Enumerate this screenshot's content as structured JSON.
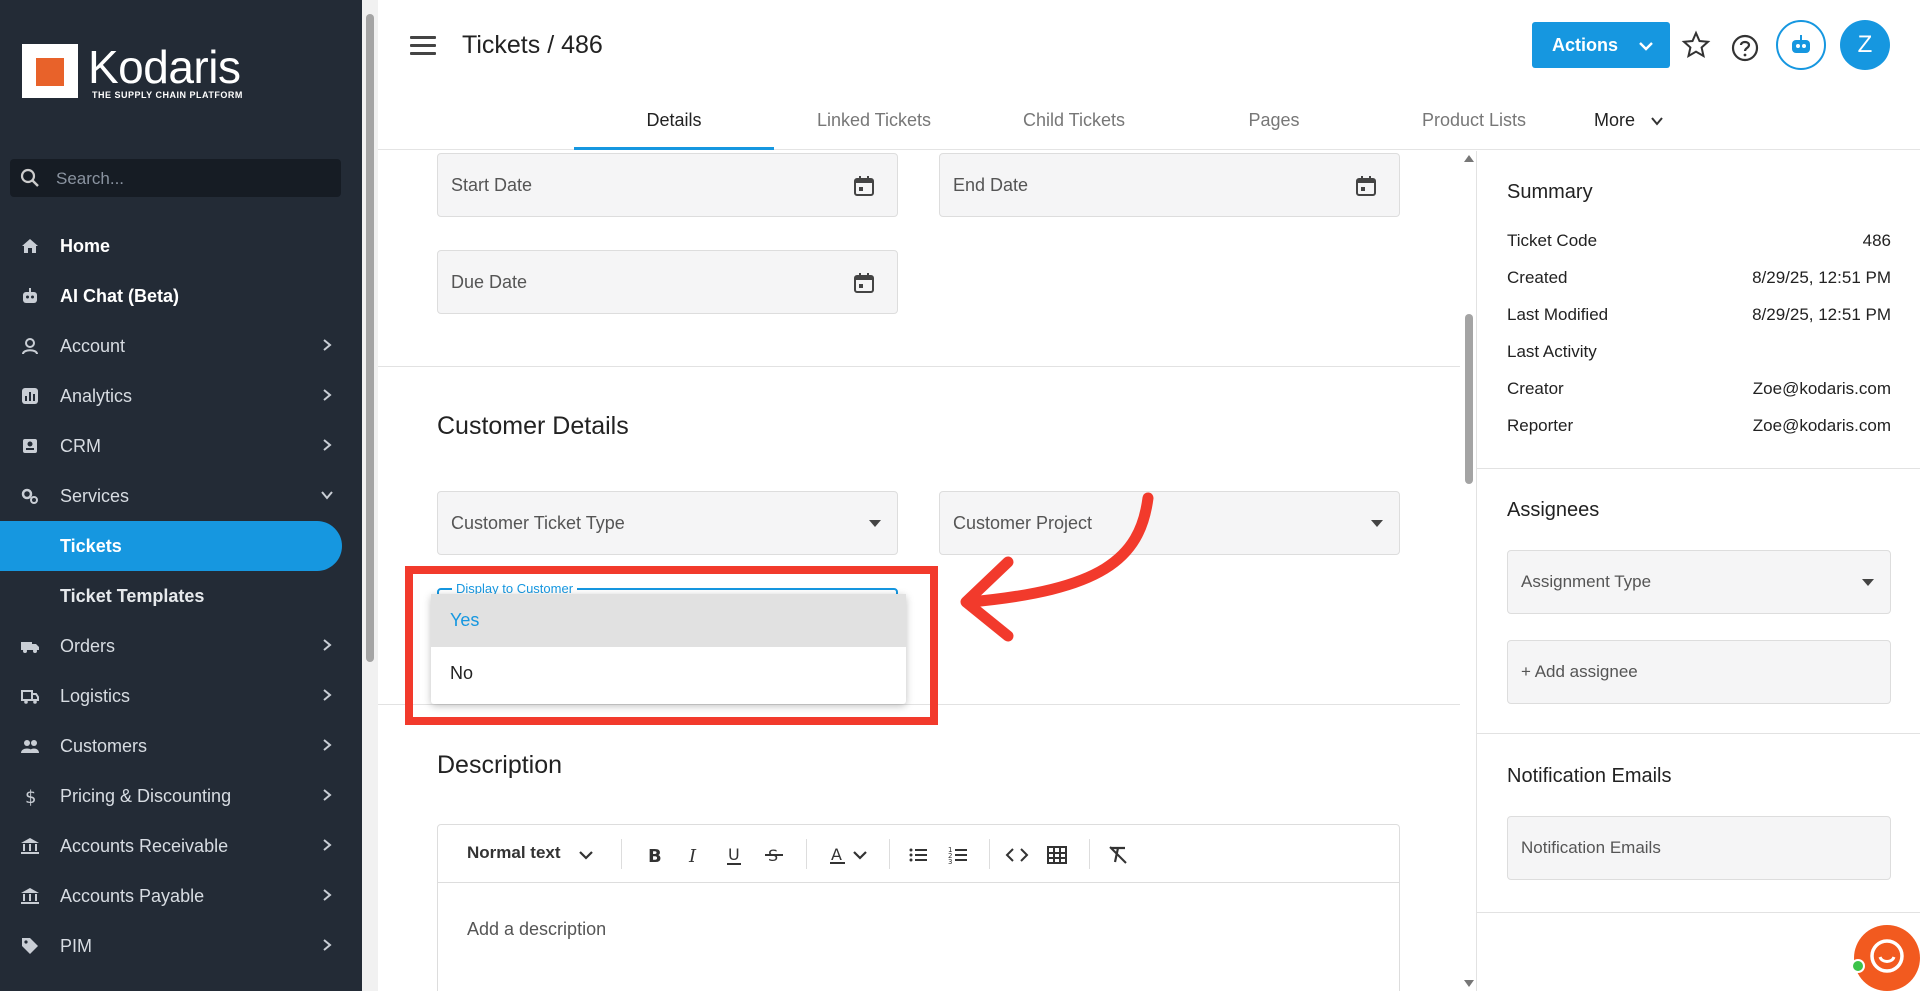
{
  "sidebar": {
    "logo_text": "Kodaris",
    "logo_subtitle": "THE SUPPLY CHAIN PLATFORM",
    "search_placeholder": "Search...",
    "items": [
      {
        "label": "Home",
        "icon": "home-icon"
      },
      {
        "label": "AI Chat (Beta)",
        "icon": "robot-icon"
      },
      {
        "label": "Account",
        "icon": "user-icon"
      },
      {
        "label": "Analytics",
        "icon": "analytics-icon"
      },
      {
        "label": "CRM",
        "icon": "crm-icon"
      },
      {
        "label": "Services",
        "icon": "services-icon"
      },
      {
        "label": "Tickets"
      },
      {
        "label": "Ticket Templates"
      },
      {
        "label": "Orders",
        "icon": "truck-icon"
      },
      {
        "label": "Logistics",
        "icon": "logistics-icon"
      },
      {
        "label": "Customers",
        "icon": "customers-icon"
      },
      {
        "label": "Pricing & Discounting",
        "icon": "dollar-icon"
      },
      {
        "label": "Accounts Receivable",
        "icon": "bank-icon"
      },
      {
        "label": "Accounts Payable",
        "icon": "bank-icon"
      },
      {
        "label": "PIM",
        "icon": "tag-icon"
      }
    ]
  },
  "header": {
    "title": "Tickets / 486",
    "actions_label": "Actions",
    "avatar_initial": "Z",
    "tabs": [
      "Details",
      "Linked Tickets",
      "Child Tickets",
      "Pages",
      "Product Lists",
      "More"
    ]
  },
  "form": {
    "start_date": "Start Date",
    "end_date": "End Date",
    "due_date": "Due Date",
    "customer_section_title": "Customer Details",
    "customer_ticket_type": "Customer Ticket Type",
    "customer_project": "Customer Project",
    "display_to_customer_label": "Display to Customer",
    "dropdown_options": [
      "Yes",
      "No"
    ],
    "description_title": "Description",
    "editor": {
      "format": "Normal text",
      "placeholder": "Add a description"
    }
  },
  "summary": {
    "title": "Summary",
    "rows": [
      {
        "key": "Ticket Code",
        "value": "486"
      },
      {
        "key": "Created",
        "value": "8/29/25, 12:51 PM"
      },
      {
        "key": "Last Modified",
        "value": "8/29/25, 12:51 PM"
      },
      {
        "key": "Last Activity",
        "value": ""
      },
      {
        "key": "Creator",
        "value": "Zoe@kodaris.com"
      },
      {
        "key": "Reporter",
        "value": "Zoe@kodaris.com"
      }
    ]
  },
  "assignees": {
    "title": "Assignees",
    "assignment_type": "Assignment Type",
    "add_assignee": "+ Add assignee"
  },
  "notifications": {
    "title": "Notification Emails",
    "placeholder": "Notification Emails"
  },
  "colors": {
    "accent": "#1697e0",
    "sidebar_bg": "#232b36",
    "annotation": "#f23a2c"
  }
}
